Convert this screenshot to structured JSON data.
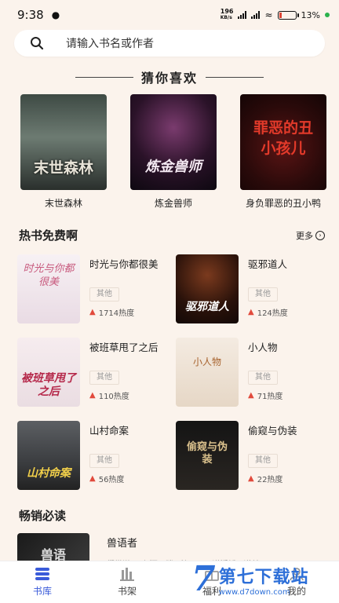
{
  "status": {
    "time": "9:38",
    "net_speed": "196",
    "net_unit": "KB/s",
    "battery": "13%"
  },
  "search": {
    "placeholder": "请输入书名或作者"
  },
  "guess": {
    "title": "猜你喜欢",
    "books": [
      {
        "name": "末世森林",
        "cover_text": "末世森林"
      },
      {
        "name": "炼金兽师",
        "cover_text": "炼金兽师"
      },
      {
        "name": "身负罪恶的丑小鸭",
        "cover_text": "罪恶的丑小孩儿"
      }
    ]
  },
  "free": {
    "title": "热书免费啊",
    "more": "更多",
    "books": [
      {
        "title": "时光与你都很美",
        "tag": "其他",
        "heat": "1714热度",
        "cover_text": "时光与你都很美"
      },
      {
        "title": "驱邪道人",
        "tag": "其他",
        "heat": "124热度",
        "cover_text": "驱邪道人"
      },
      {
        "title": "被班草甩了之后",
        "tag": "其他",
        "heat": "110热度",
        "cover_text": "被班草甩了之后"
      },
      {
        "title": "小人物",
        "tag": "其他",
        "heat": "71热度",
        "cover_text": "小人物"
      },
      {
        "title": "山村命案",
        "tag": "其他",
        "heat": "56热度",
        "cover_text": "山村命案"
      },
      {
        "title": "偷窥与伪装",
        "tag": "其他",
        "heat": "22热度",
        "cover_text": "偷窥与伪装"
      }
    ]
  },
  "bestseller": {
    "title": "畅销必读",
    "books": [
      {
        "title": "兽语者",
        "desc": "们常说：\"九河下梢天津卫，三道浮桥两道关！\"又",
        "cover_text": "兽语"
      }
    ]
  },
  "tabs": [
    {
      "label": "书库",
      "icon": "library-icon"
    },
    {
      "label": "书架",
      "icon": "bookshelf-icon"
    },
    {
      "label": "福利",
      "icon": "gift-icon"
    },
    {
      "label": "我的",
      "icon": "user-icon"
    }
  ],
  "watermark": {
    "brand": "第七下载站",
    "url": "www.d7down.com",
    "logo": "7"
  },
  "colors": {
    "accent": "#3a5bd9",
    "heat": "#e14a3c",
    "background": "#fbf3ec"
  }
}
